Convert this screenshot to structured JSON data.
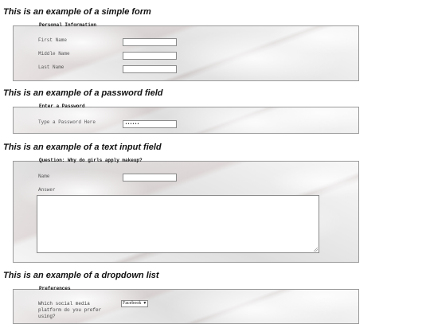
{
  "sections": [
    {
      "heading": "This is an example of a simple form",
      "legend": "Personal Information",
      "fields": [
        {
          "label": "First Name",
          "value": ""
        },
        {
          "label": "Middle Name",
          "value": ""
        },
        {
          "label": "Last Name",
          "value": ""
        }
      ]
    },
    {
      "heading": "This is an example of a password field",
      "legend": "Enter a Password",
      "fields": [
        {
          "label": "Type a Password Here",
          "value": "••••••"
        }
      ]
    },
    {
      "heading": "This is an example of a text input field",
      "legend": "Question: Why do girls apply makeup?",
      "name_label": "Name",
      "name_value": "",
      "answer_label": "Answer",
      "answer_value": ""
    },
    {
      "heading": "This is an example of a dropdown list",
      "legend": "Preferences",
      "question": "Which social media platform do you prefer using?",
      "selected": "Facebook"
    }
  ]
}
